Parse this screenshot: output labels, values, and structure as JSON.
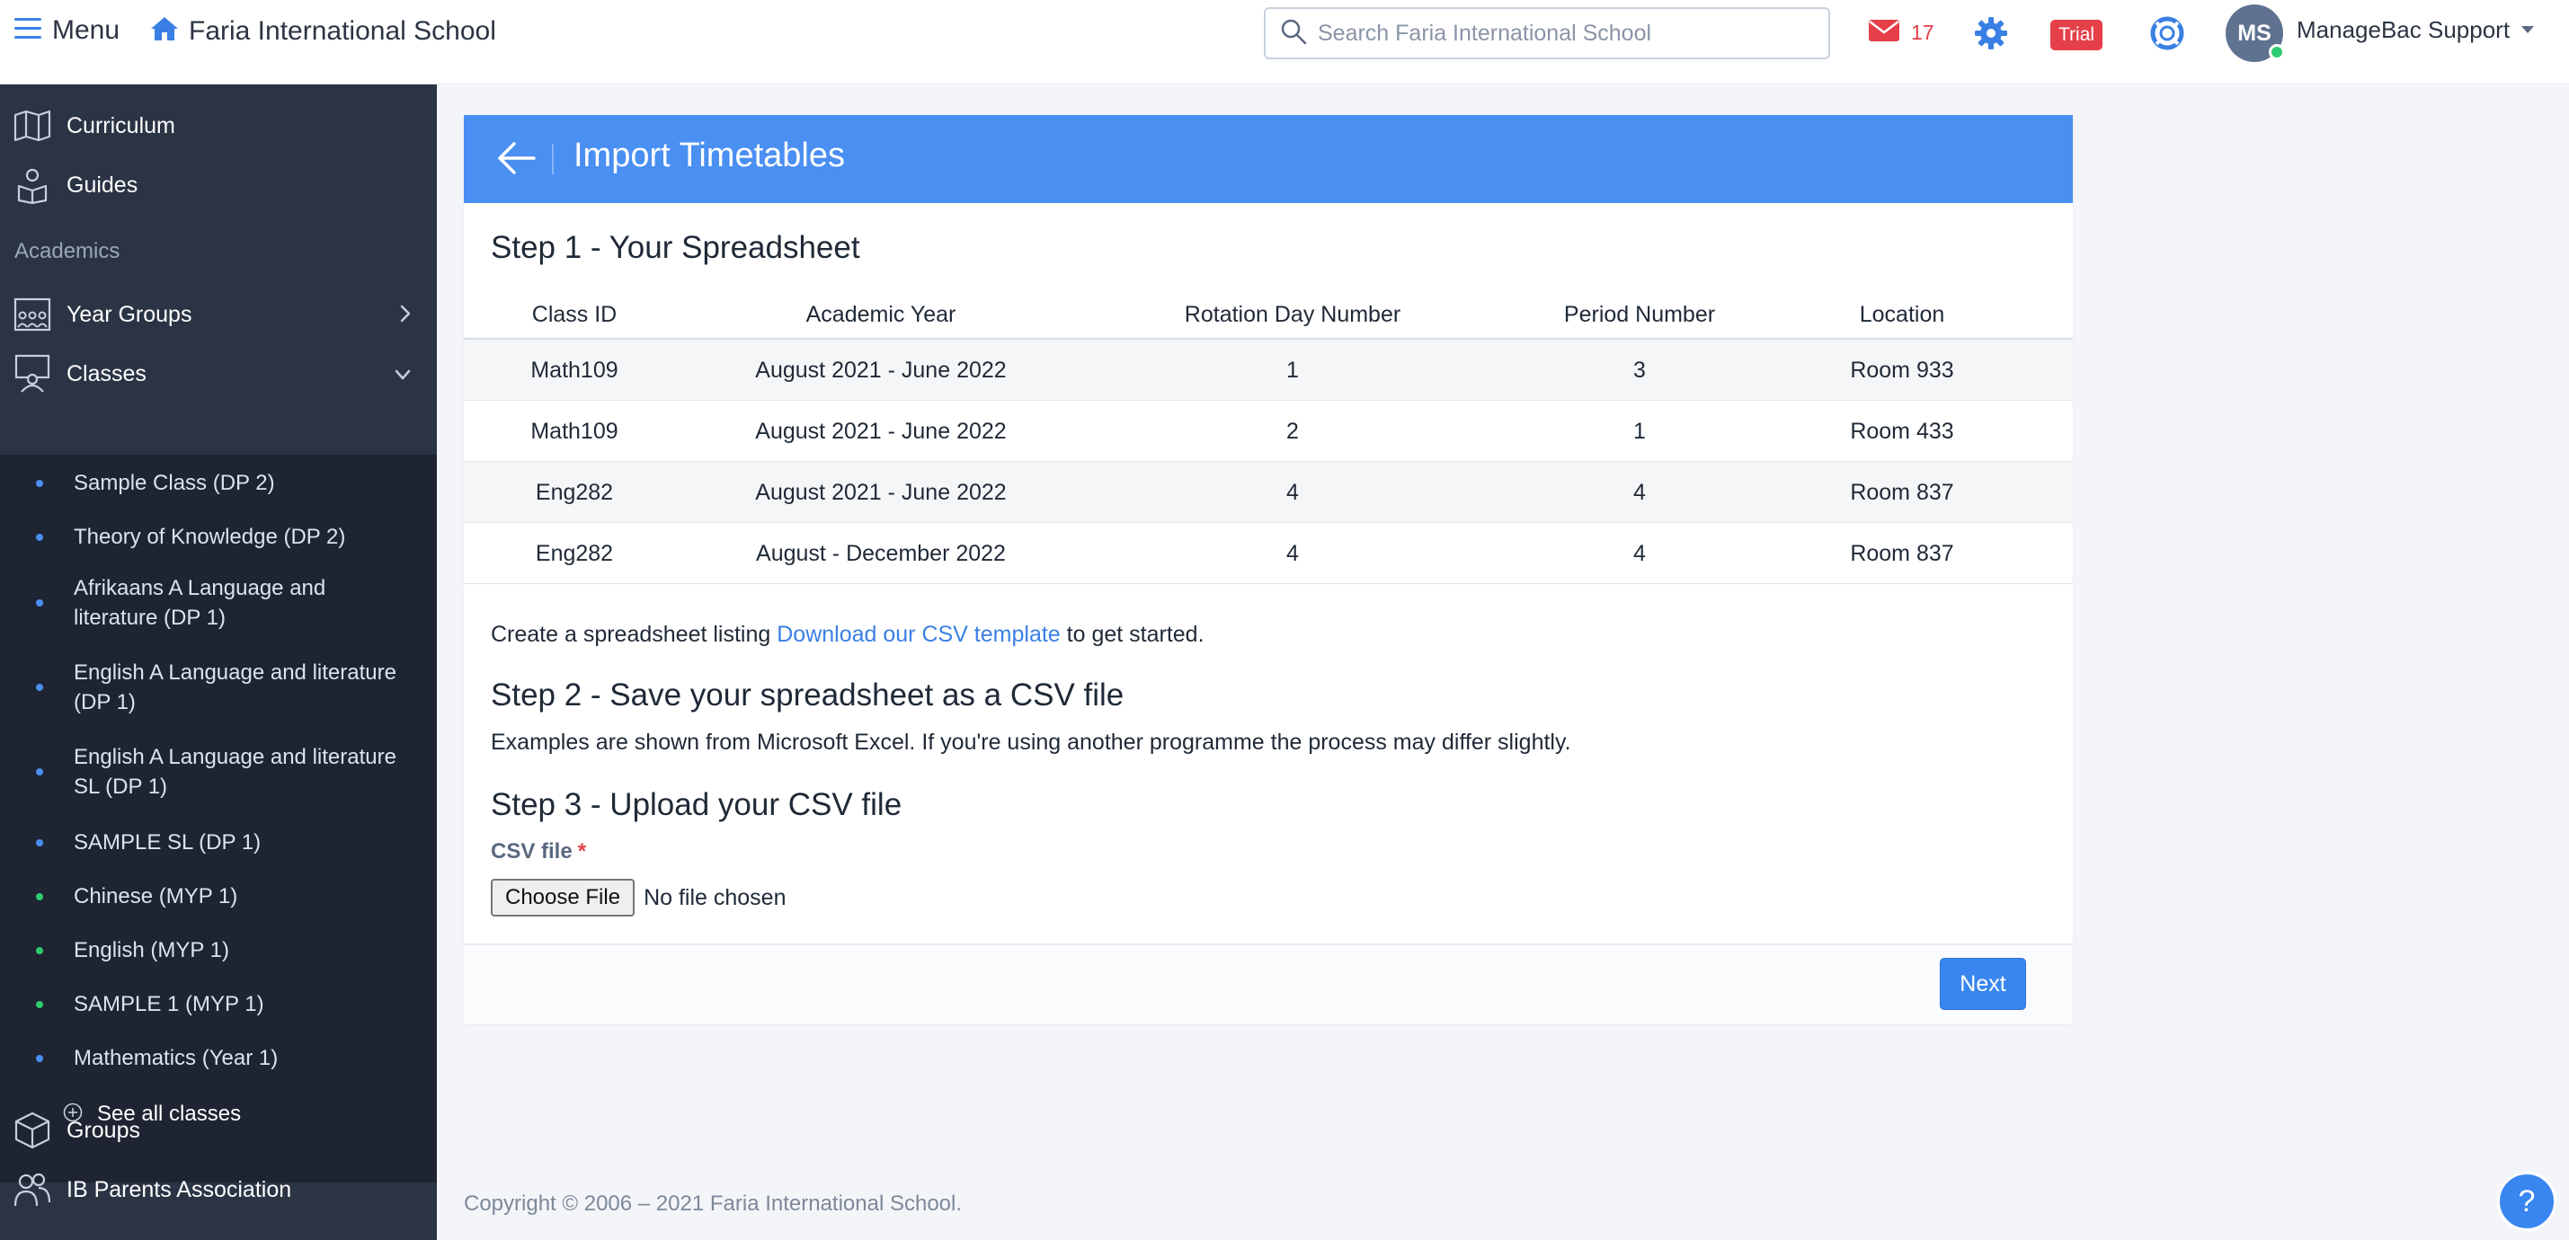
{
  "topbar": {
    "menu_label": "Menu",
    "school_name": "Faria International School",
    "search_placeholder": "Search Faria International School",
    "mail_count": "17",
    "trial_label": "Trial",
    "avatar_initials": "MS",
    "user_name": "ManageBac Support"
  },
  "sidebar": {
    "top_items": [
      {
        "label": "Curriculum",
        "icon": "map-icon"
      },
      {
        "label": "Guides",
        "icon": "guides-icon"
      }
    ],
    "section_label": "Academics",
    "year_groups_label": "Year Groups",
    "classes_label": "Classes",
    "classes": [
      {
        "label": "Sample Class (DP 2)",
        "color": "#4a8ff2"
      },
      {
        "label": "Theory of Knowledge (DP 2)",
        "color": "#4a8ff2"
      },
      {
        "label": "Afrikaans A Language and literature (DP 1)",
        "color": "#4a8ff2"
      },
      {
        "label": "English A Language and literature (DP 1)",
        "color": "#4a8ff2"
      },
      {
        "label": "English A Language and literature SL (DP 1)",
        "color": "#4a8ff2"
      },
      {
        "label": "SAMPLE SL (DP 1)",
        "color": "#4a8ff2"
      },
      {
        "label": "Chinese (MYP 1)",
        "color": "#2ecc71"
      },
      {
        "label": "English (MYP 1)",
        "color": "#2ecc71"
      },
      {
        "label": "SAMPLE 1 (MYP 1)",
        "color": "#2ecc71"
      },
      {
        "label": "Mathematics (Year 1)",
        "color": "#4a8ff2"
      }
    ],
    "see_all_label": "See all classes",
    "groups_label": "Groups",
    "parents_label": "IB Parents Association"
  },
  "card": {
    "title": "Import Timetables",
    "step1_title": "Step 1 - Your Spreadsheet",
    "columns": [
      "Class ID",
      "Academic Year",
      "Rotation Day Number",
      "Period Number",
      "Location"
    ],
    "rows": [
      [
        "Math109",
        "August 2021 - June 2022",
        "1",
        "3",
        "Room 933"
      ],
      [
        "Math109",
        "August 2021 - June 2022",
        "2",
        "1",
        "Room 433"
      ],
      [
        "Eng282",
        "August 2021 - June 2022",
        "4",
        "4",
        "Room 837"
      ],
      [
        "Eng282",
        "August - December 2022",
        "4",
        "4",
        "Room 837"
      ]
    ],
    "create_text_before": "Create a spreadsheet listing ",
    "template_link": "Download our CSV template",
    "create_text_after": " to get started.",
    "step2_title": "Step 2 - Save your spreadsheet as a CSV file",
    "step2_text": "Examples are shown from Microsoft Excel. If you're using another programme the process may differ slightly.",
    "step3_title": "Step 3 - Upload your CSV file",
    "csv_label": "CSV file",
    "required_mark": "*",
    "choose_file": "Choose File",
    "no_file": "No file chosen",
    "next_label": "Next"
  },
  "footer": {
    "copyright": "Copyright © 2006 – 2021 Faria International School.",
    "help_glyph": "?"
  },
  "colors": {
    "accent": "#4a8ff2",
    "sidebar_bg": "#2b3445",
    "danger": "#e5404a"
  }
}
